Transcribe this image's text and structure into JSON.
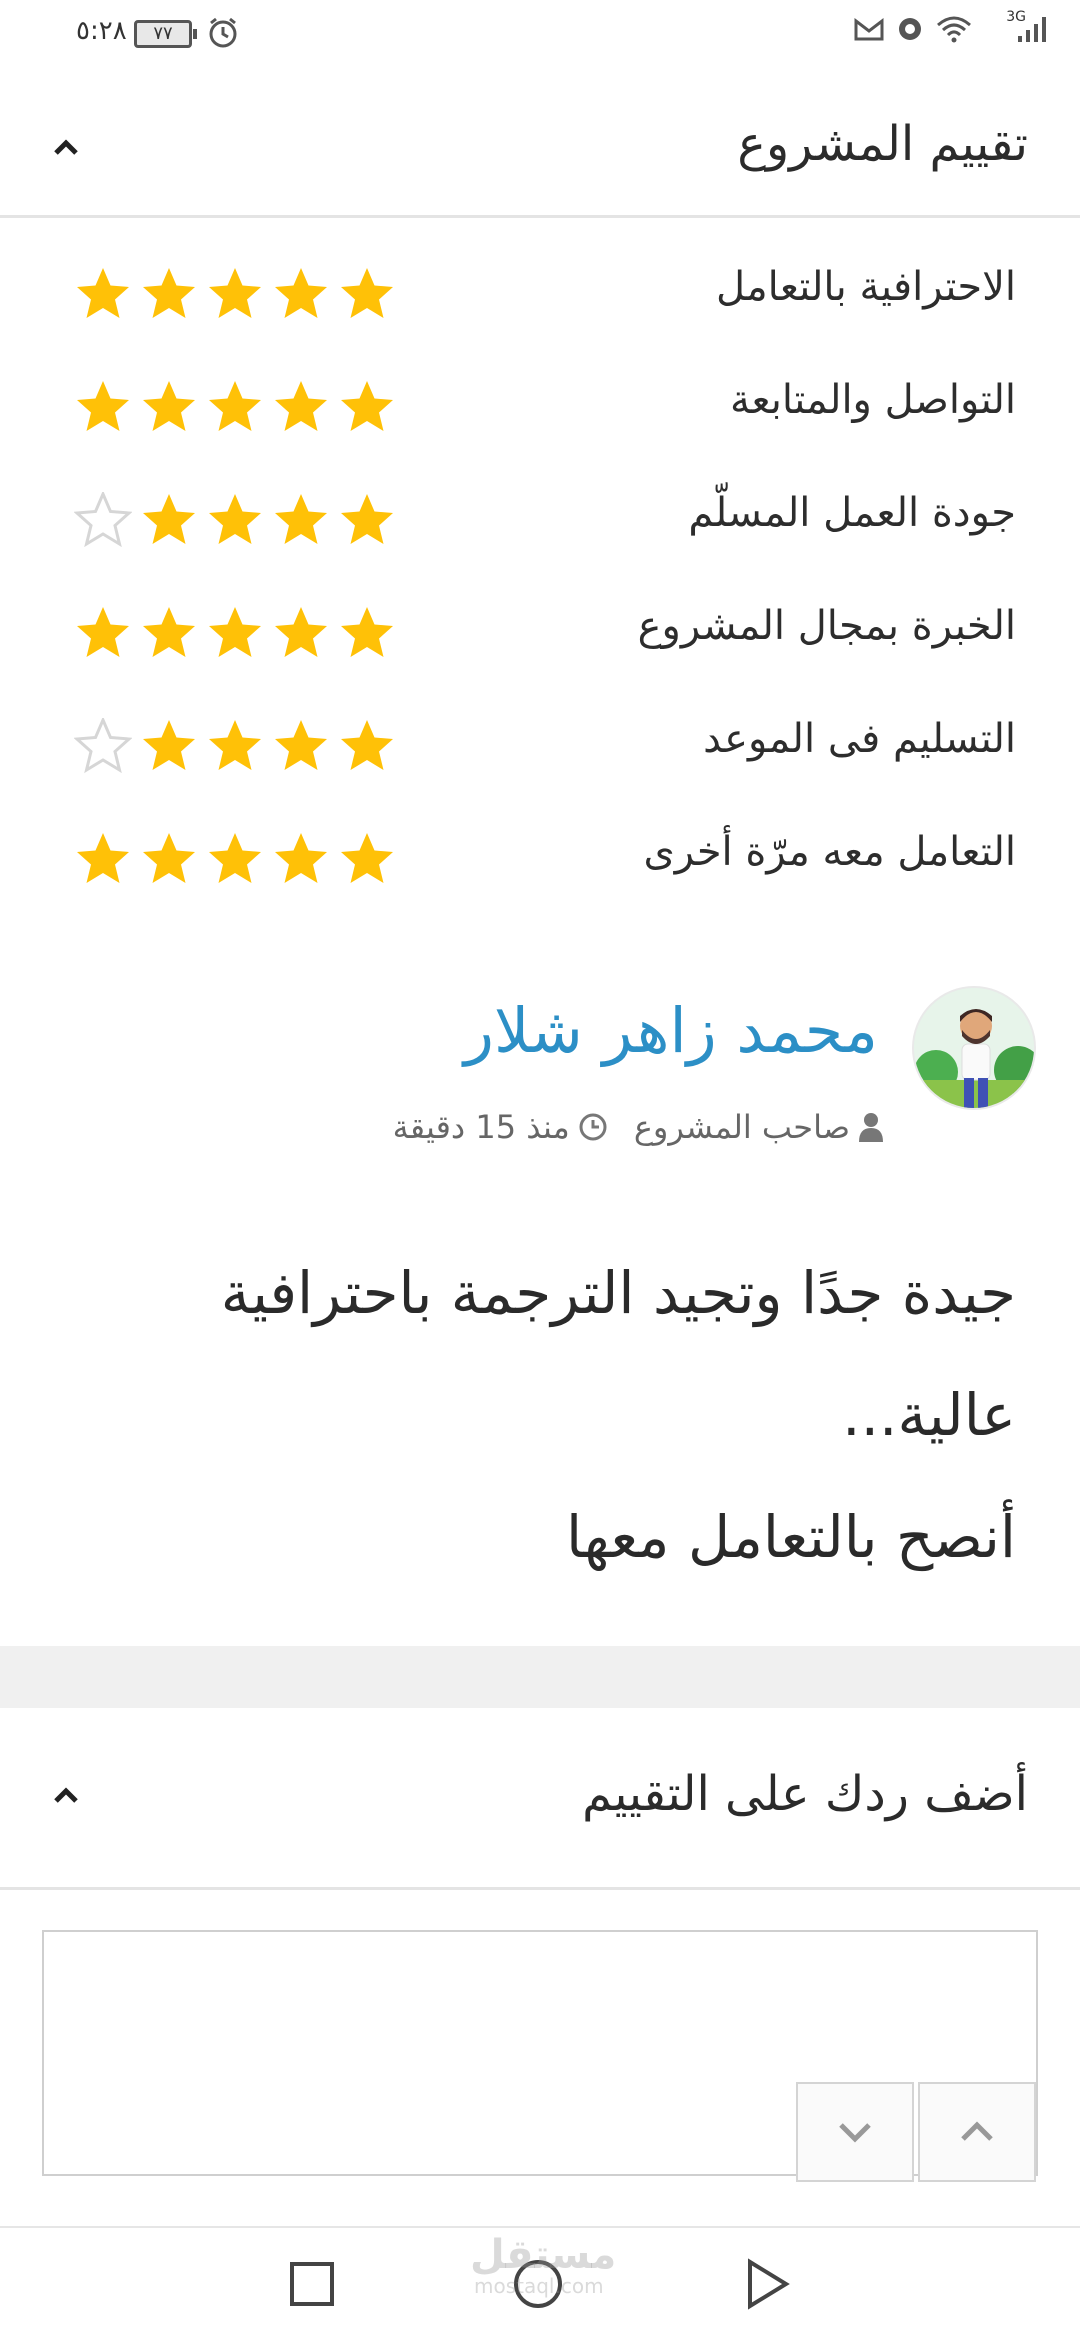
{
  "status_bar": {
    "time": "٥:٢٨",
    "battery": "٧٧",
    "network": "3G"
  },
  "project_rating": {
    "title": "تقييم المشروع",
    "items": [
      {
        "label": "الاحترافية بالتعامل",
        "stars": 5
      },
      {
        "label": "التواصل والمتابعة",
        "stars": 5
      },
      {
        "label": "جودة العمل المسلّم",
        "stars": 4
      },
      {
        "label": "الخبرة بمجال المشروع",
        "stars": 5
      },
      {
        "label": "التسليم فى الموعد",
        "stars": 4
      },
      {
        "label": "التعامل معه مرّة أخرى",
        "stars": 5
      }
    ],
    "max_stars": 5
  },
  "review": {
    "reviewer_name": "محمد زاهر شلار",
    "role": "صاحب المشروع",
    "time": "منذ 15 دقيقة",
    "text_line1": "جيدة جدًا وتجيد الترجمة باحترافية",
    "text_line2": "عالية...",
    "text_line3": "أنصح بالتعامل معها"
  },
  "reply": {
    "title": "أضف ردك على التقييم",
    "textarea_value": ""
  },
  "watermark": {
    "text": "مستقل",
    "sub": "mostaql.com"
  },
  "colors": {
    "star": "#FFC107",
    "star_empty": "#d6d6d6",
    "name": "#2c8fc6"
  }
}
